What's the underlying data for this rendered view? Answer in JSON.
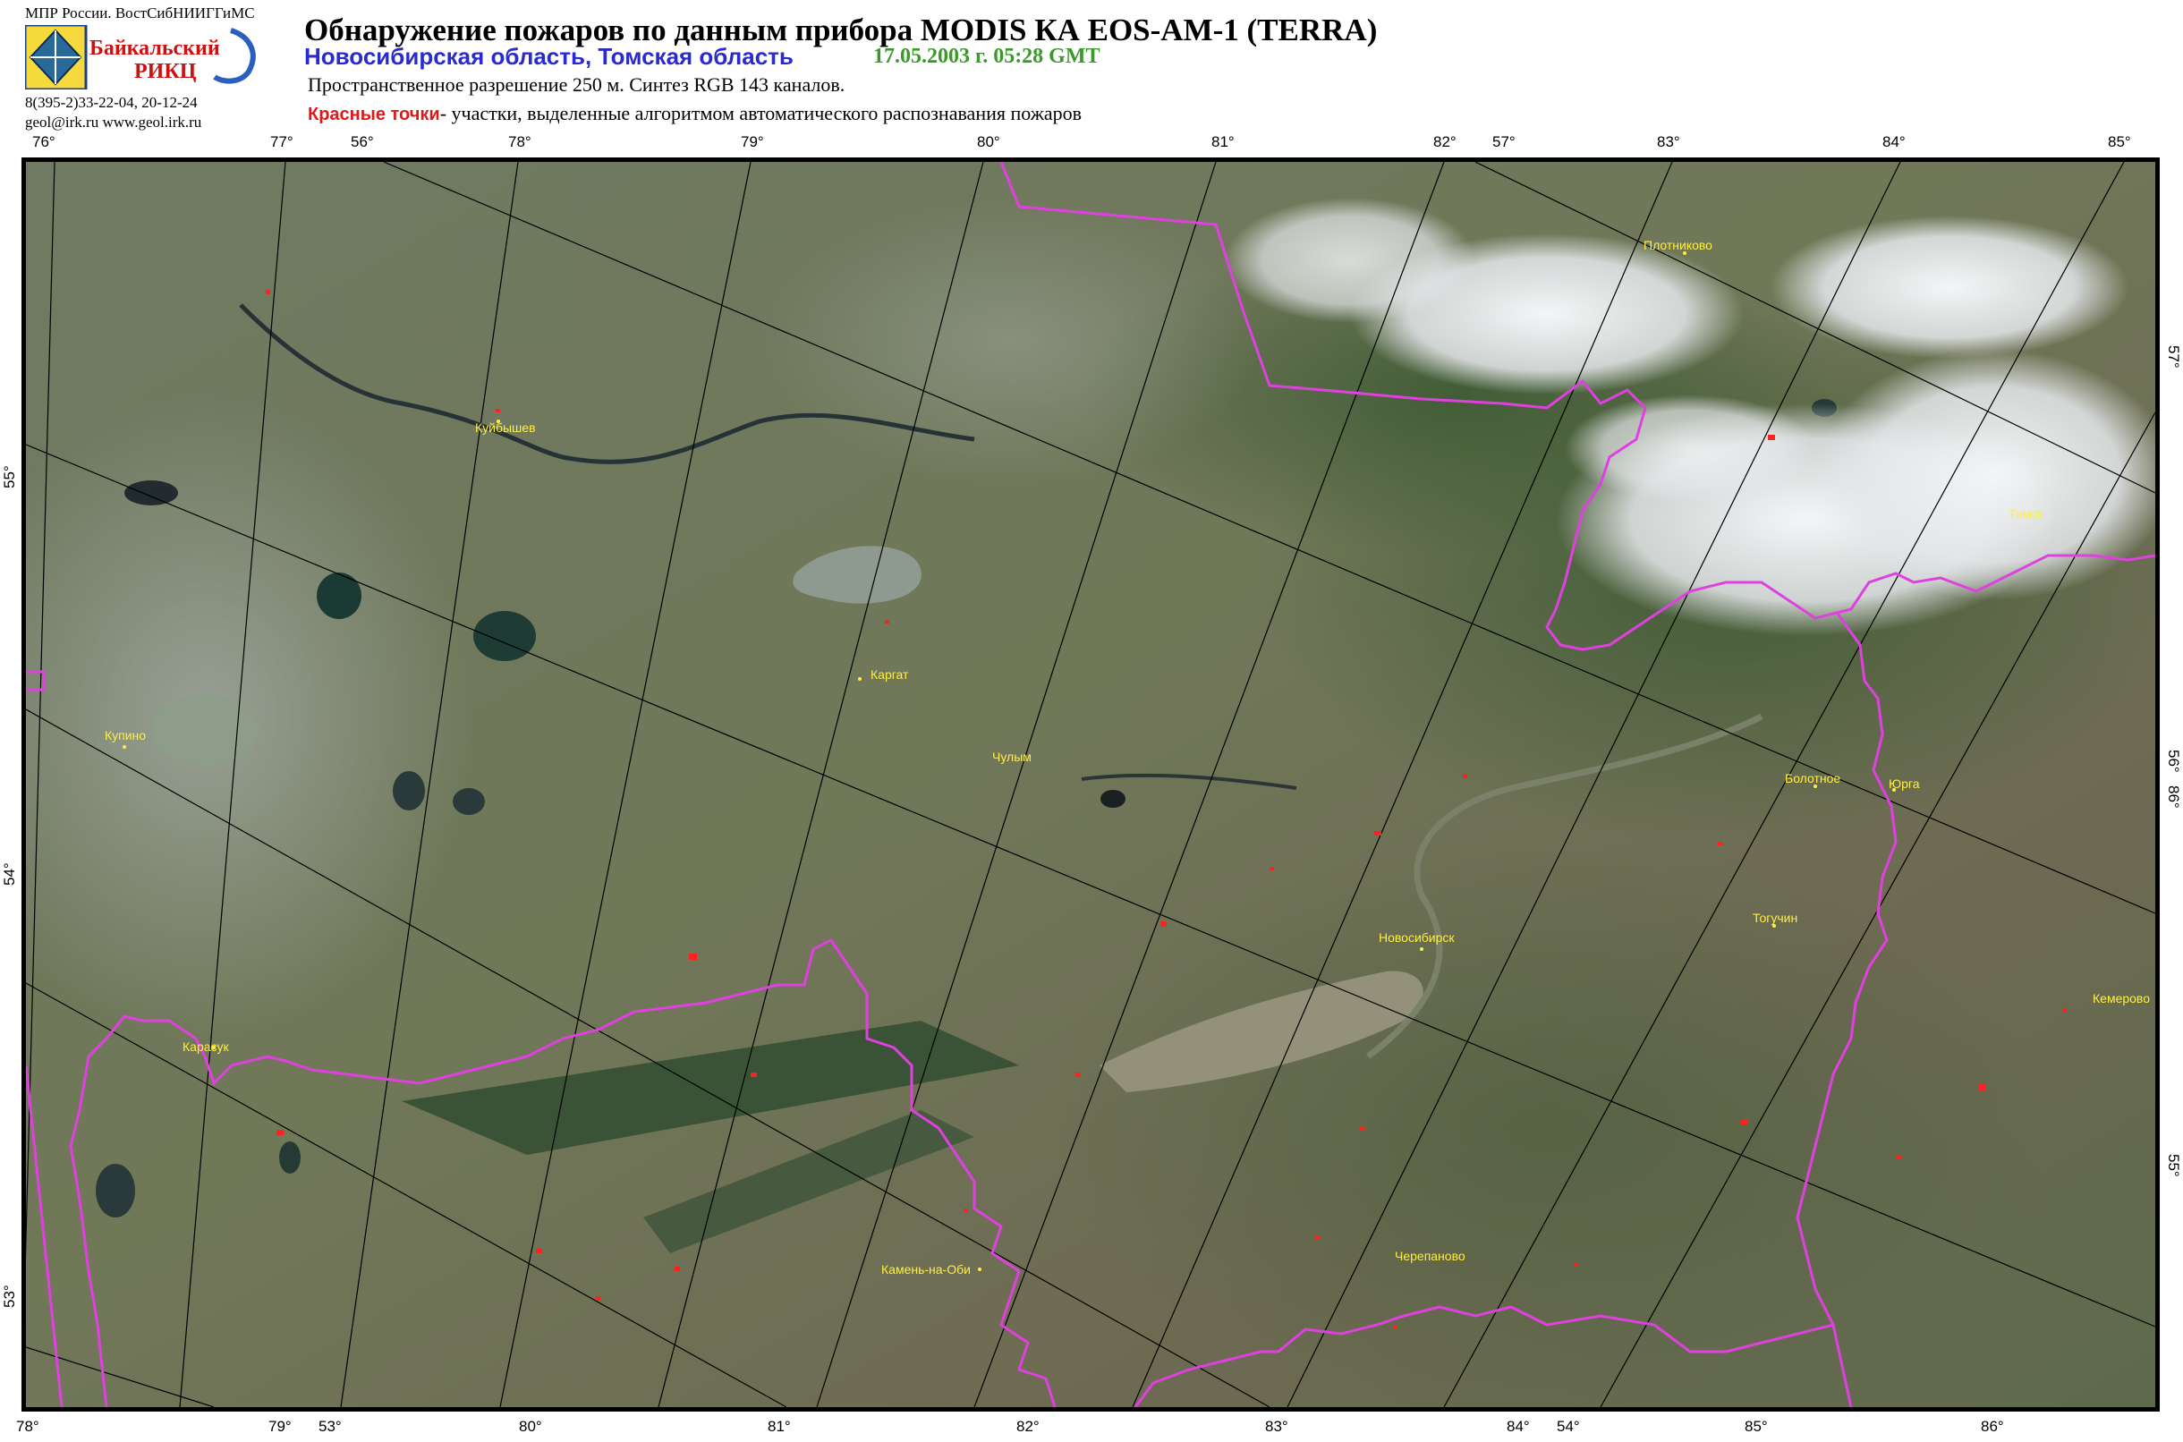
{
  "header": {
    "org_line": "МПР России. ВостСибНИИГГиМС",
    "logo_text_1": "Байкальский",
    "logo_text_2": "РИКЦ",
    "phone": "8(395-2)33-22-04, 20-12-24",
    "contacts": "geol@irk.ru  www.geol.irk.ru",
    "title": "Обнаружение пожаров по данным прибора MODIS КА EOS-AM-1 (TERRA)",
    "regions": "Новосибирская область, Томская область",
    "datetime": "17.05.2003 г.  05:28 GMT",
    "resolution": "Пространственное разрешение 250 м. Синтез RGB 143 каналов.",
    "legend_red": "Красные точки",
    "legend_text": "- участки, выделенные алгоритмом автоматического распознавания пожаров"
  },
  "colors": {
    "boundary": "#e040e0",
    "fire": "#ff2020",
    "city_label": "#ffee44",
    "regions_text": "#2a2acf",
    "datetime_text": "#3a9a2a"
  },
  "top_ticks": [
    "76°",
    "77°",
    "56°",
    "78°",
    "79°",
    "80°",
    "81°",
    "82°",
    "57°",
    "83°",
    "84°",
    "85°"
  ],
  "bottom_ticks": [
    "78°",
    "79°",
    "53°",
    "80°",
    "81°",
    "82°",
    "83°",
    "84°",
    "54°",
    "85°",
    "86°"
  ],
  "left_ticks": [
    "55°",
    "54°",
    "53°"
  ],
  "right_ticks": [
    "57°",
    "56°",
    "86°",
    "55°"
  ],
  "cities": [
    "Плотниково",
    "Куйбышев",
    "Томск",
    "Каргат",
    "Купино",
    "Чулым",
    "Болотное",
    "Юрга",
    "Тогучин",
    "Новосибирск",
    "Кемерово",
    "Карасук",
    "Черепаново",
    "Камень-на-Оби"
  ]
}
